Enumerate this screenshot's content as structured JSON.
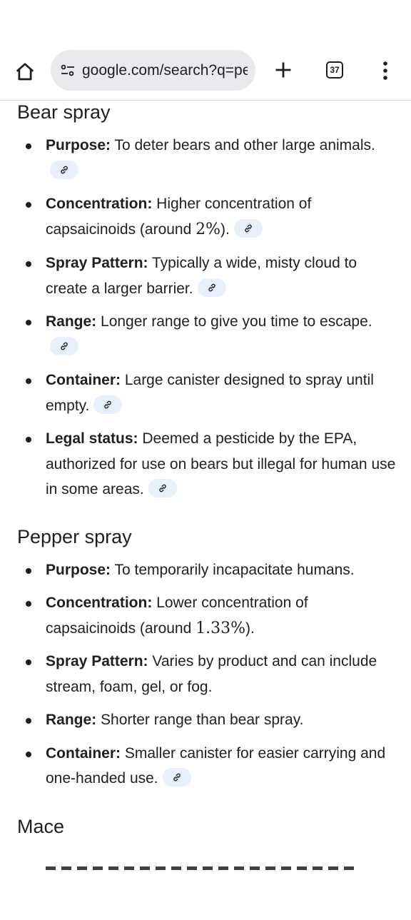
{
  "browser": {
    "url": "google.com/search?q=pe",
    "tab_count": "37",
    "icons": [
      "home-icon",
      "tune-icon",
      "plus-icon",
      "tab-switcher-icon",
      "more-vert-icon",
      "link-icon"
    ]
  },
  "sections": [
    {
      "title": "Bear spray",
      "items": [
        {
          "label": "Purpose:",
          "text": " To deter bears and other large animals."
        },
        {
          "label": "Concentration:",
          "text_before": " Higher concentration of capsaicinoids (around ",
          "num": "2%",
          "text_after": ")."
        },
        {
          "label": "Spray Pattern:",
          "text": " Typically a wide, misty cloud to create a larger barrier."
        },
        {
          "label": "Range:",
          "text": " Longer range to give you time to escape."
        },
        {
          "label": "Container:",
          "text": " Large canister designed to spray until empty."
        },
        {
          "label": "Legal status:",
          "text": " Deemed a pesticide by the EPA, authorized for use on bears but illegal for human use in some areas."
        }
      ]
    },
    {
      "title": "Pepper spray",
      "items": [
        {
          "label": "Purpose:",
          "text": " To temporarily incapacitate humans."
        },
        {
          "label": "Concentration:",
          "text_before": " Lower concentration of capsaicinoids (around ",
          "num": "1.33%",
          "text_after": ")."
        },
        {
          "label": "Spray Pattern:",
          "text": " Varies by product and can include stream, foam, gel, or fog."
        },
        {
          "label": "Range:",
          "text": " Shorter range than bear spray."
        },
        {
          "label": "Container:",
          "text": " Smaller canister for easier carrying and one-handed use."
        }
      ]
    },
    {
      "title": "Mace"
    }
  ]
}
